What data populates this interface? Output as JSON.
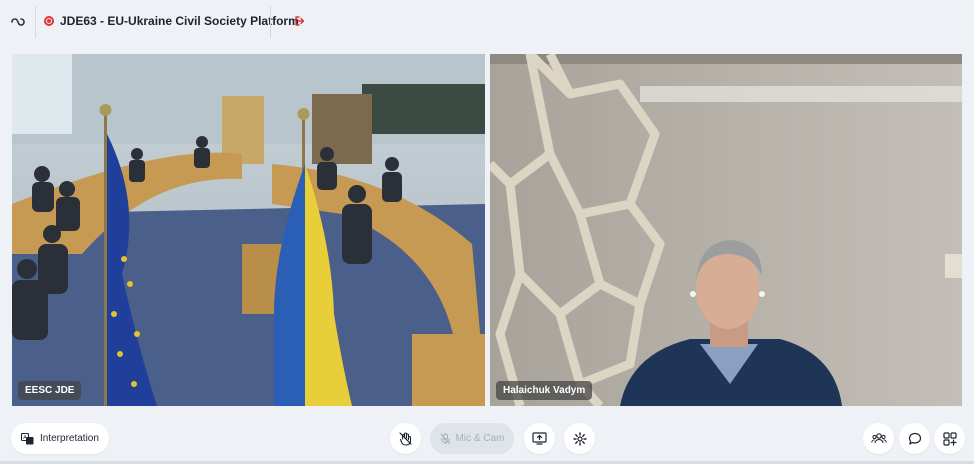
{
  "header": {
    "meeting_title": "JDE63 - EU-Ukraine Civil Society Platform",
    "app_icon": "link-loop-icon",
    "leave_icon": "leave-meeting-icon",
    "recording_color": "#e0353b"
  },
  "tiles": [
    {
      "participant_name": "EESC JDE"
    },
    {
      "participant_name": "Halaichuk Vadym"
    }
  ],
  "toolbar": {
    "interpretation_label": "Interpretation",
    "mic_cam_label": "Mic & Cam",
    "icons": [
      "hand-off-icon",
      "microphone-off-icon",
      "share-screen-icon",
      "settings-icon",
      "participants-icon",
      "chat-icon",
      "apps-grid-icon"
    ]
  }
}
